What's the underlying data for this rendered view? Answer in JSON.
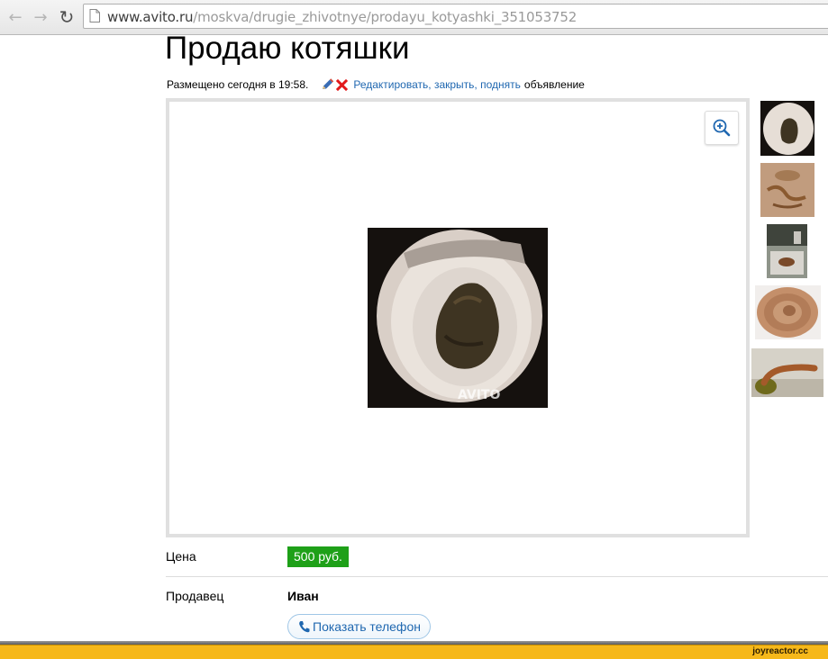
{
  "browser": {
    "url_host": "www.avito.ru",
    "url_path": "/moskva/drugie_zhivotnye/prodayu_kotyashki_351053752"
  },
  "listing": {
    "title": "Продаю котяшки",
    "posted": "Размещено сегодня в 19:58.",
    "actions": {
      "edit": "Редактировать",
      "close": "закрыть",
      "raise": "поднять",
      "separator": ", ",
      "suffix": "объявление"
    },
    "photo_watermark": "AVITO",
    "price_label": "Цена",
    "price_value": "500 руб.",
    "seller_label": "Продавец",
    "seller_name": "Иван",
    "show_phone": "Показать телефон"
  },
  "watermark": {
    "text": "joyreactor.cc"
  },
  "colors": {
    "link": "#1f67b0",
    "price_badge": "#1ea018",
    "watermark_bar": "#f6b81a"
  }
}
